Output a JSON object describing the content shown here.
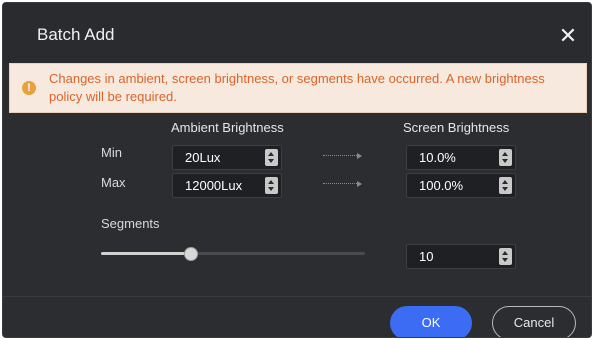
{
  "dialog": {
    "title": "Batch Add",
    "close_glyph": "✕"
  },
  "warning": {
    "icon": "!",
    "text": "Changes in ambient, screen brightness, or segments have occurred. A new brightness policy will be required."
  },
  "headers": {
    "ambient": "Ambient Brightness",
    "screen": "Screen Brightness"
  },
  "rows": {
    "min": {
      "label": "Min",
      "ambient_value": "20Lux",
      "screen_value": "10.0%"
    },
    "max": {
      "label": "Max",
      "ambient_value": "12000Lux",
      "screen_value": "100.0%"
    }
  },
  "segments": {
    "label": "Segments",
    "value": "10",
    "slider_fraction": 0.34
  },
  "buttons": {
    "ok": "OK",
    "cancel": "Cancel"
  },
  "colors": {
    "dialog_bg": "#2c2d31",
    "warning_bg": "#f7e9de",
    "warning_text": "#d8652b",
    "warning_icon": "#e9a13d",
    "primary": "#3b6cf3"
  }
}
